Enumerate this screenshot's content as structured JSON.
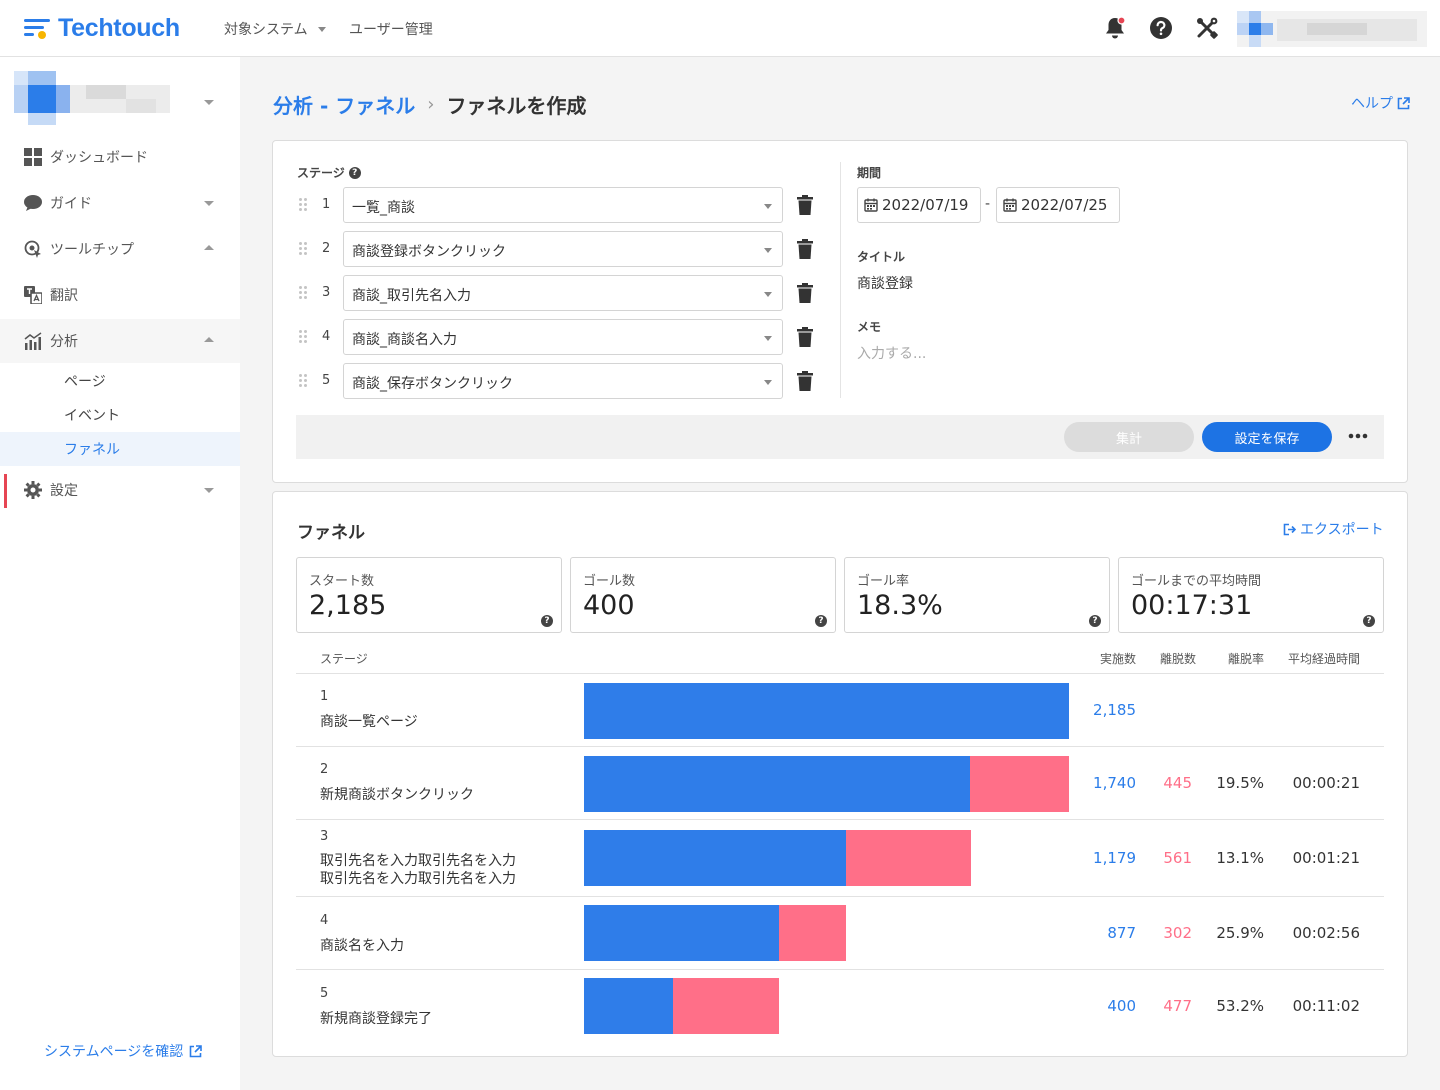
{
  "topbar": {
    "logo_text": "Techtouch",
    "nav_system": "対象システム",
    "nav_users": "ユーザー管理"
  },
  "sidebar": {
    "items": [
      {
        "label": "ダッシュボード",
        "icon": "dashboard-icon"
      },
      {
        "label": "ガイド",
        "icon": "chat-bubble-icon"
      },
      {
        "label": "ツールチップ",
        "icon": "tooltip-target-icon"
      },
      {
        "label": "翻訳",
        "icon": "translate-icon"
      },
      {
        "label": "分析",
        "icon": "analytics-icon"
      },
      {
        "label": "設定",
        "icon": "gear-icon"
      }
    ],
    "sub_items": [
      "ページ",
      "イベント",
      "ファネル"
    ],
    "system_link": "システムページを確認"
  },
  "breadcrumb": {
    "parent": "分析 - ファネル",
    "current": "ファネルを作成"
  },
  "help_link": "ヘルプ",
  "settings": {
    "stage_label": "ステージ",
    "stages": [
      {
        "num": "1",
        "value": "一覧_商談"
      },
      {
        "num": "2",
        "value": "商談登録ボタンクリック"
      },
      {
        "num": "3",
        "value": "商談_取引先名入力"
      },
      {
        "num": "4",
        "value": "商談_商談名入力"
      },
      {
        "num": "5",
        "value": "商談_保存ボタンクリック"
      }
    ],
    "period_label": "期間",
    "date_from": "2022/07/19",
    "date_sep": "-",
    "date_to": "2022/07/25",
    "title_label": "タイトル",
    "title_value": "商談登録",
    "memo_label": "メモ",
    "memo_placeholder": "入力する...",
    "aggregate_button": "集計",
    "save_button": "設定を保存"
  },
  "funnel": {
    "title": "ファネル",
    "export_label": "エクスポート",
    "stats": [
      {
        "label": "スタート数",
        "value": "2,185"
      },
      {
        "label": "ゴール数",
        "value": "400"
      },
      {
        "label": "ゴール率",
        "value": "18.3%"
      },
      {
        "label": "ゴールまでの平均時間",
        "value": "00:17:31"
      }
    ],
    "headers": {
      "stage": "ステージ",
      "count": "実施数",
      "dropoff": "離脱数",
      "dropoff_rate": "離脱率",
      "avg_time": "平均経過時間"
    },
    "rows": [
      {
        "num": "1",
        "name": "商談一覧ページ",
        "count": "2,185",
        "dropoff": "",
        "rate": "",
        "time": "",
        "count_value": 2185,
        "drop_value": 0
      },
      {
        "num": "2",
        "name": "新規商談ボタンクリック",
        "count": "1,740",
        "dropoff": "445",
        "rate": "19.5%",
        "time": "00:00:21",
        "count_value": 1740,
        "drop_value": 445
      },
      {
        "num": "3",
        "name": "取引先名を入力取引先名を入力\n取引先名を入力取引先名を入力",
        "count": "1,179",
        "dropoff": "561",
        "rate": "13.1%",
        "time": "00:01:21",
        "count_value": 1179,
        "drop_value": 561
      },
      {
        "num": "4",
        "name": "商談名を入力",
        "count": "877",
        "dropoff": "302",
        "rate": "25.9%",
        "time": "00:02:56",
        "count_value": 877,
        "drop_value": 302
      },
      {
        "num": "5",
        "name": "新規商談登録完了",
        "count": "400",
        "dropoff": "477",
        "rate": "53.2%",
        "time": "00:11:02",
        "count_value": 400,
        "drop_value": 477
      }
    ]
  },
  "colors": {
    "accent": "#2b7de9",
    "bar_blue": "#2f7de9",
    "bar_pink": "#ff6f88",
    "active_marker": "#e64553"
  }
}
